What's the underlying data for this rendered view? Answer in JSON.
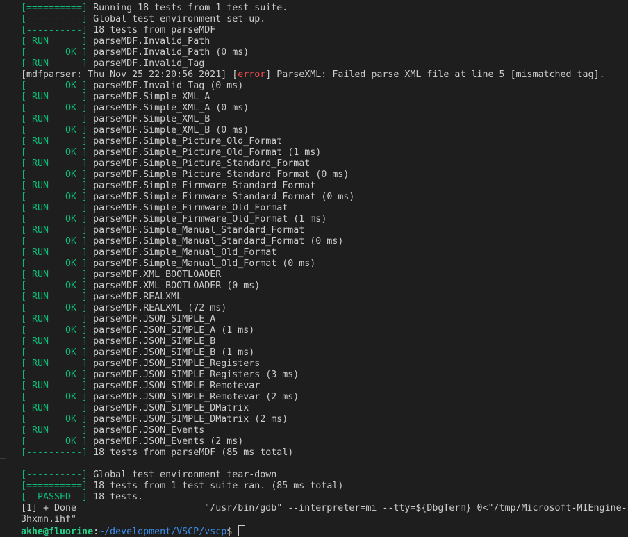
{
  "terminal": {
    "lines": [
      {
        "tag": "[==========]",
        "text": "Running 18 tests from 1 test suite."
      },
      {
        "tag": "[----------]",
        "text": "Global test environment set-up."
      },
      {
        "tag": "[----------]",
        "text": "18 tests from parseMDF"
      },
      {
        "tag": "[ RUN      ]",
        "text": "parseMDF.Invalid_Path"
      },
      {
        "tag": "[       OK ]",
        "text": "parseMDF.Invalid_Path (0 ms)"
      },
      {
        "tag": "[ RUN      ]",
        "text": "parseMDF.Invalid_Tag"
      },
      {
        "pre": "[mdfparser: Thu Nov 25 22:20:56 2021] [",
        "err": "error",
        "post": "] ParseXML: Failed parse XML file at line 5 [mismatched tag]."
      },
      {
        "tag": "[       OK ]",
        "text": "parseMDF.Invalid_Tag (0 ms)"
      },
      {
        "tag": "[ RUN      ]",
        "text": "parseMDF.Simple_XML_A"
      },
      {
        "tag": "[       OK ]",
        "text": "parseMDF.Simple_XML_A (0 ms)"
      },
      {
        "tag": "[ RUN      ]",
        "text": "parseMDF.Simple_XML_B"
      },
      {
        "tag": "[       OK ]",
        "text": "parseMDF.Simple_XML_B (0 ms)"
      },
      {
        "tag": "[ RUN      ]",
        "text": "parseMDF.Simple_Picture_Old_Format"
      },
      {
        "tag": "[       OK ]",
        "text": "parseMDF.Simple_Picture_Old_Format (1 ms)"
      },
      {
        "tag": "[ RUN      ]",
        "text": "parseMDF.Simple_Picture_Standard_Format"
      },
      {
        "tag": "[       OK ]",
        "text": "parseMDF.Simple_Picture_Standard_Format (0 ms)"
      },
      {
        "tag": "[ RUN      ]",
        "text": "parseMDF.Simple_Firmware_Standard_Format"
      },
      {
        "tag": "[       OK ]",
        "text": "parseMDF.Simple_Firmware_Standard_Format (0 ms)"
      },
      {
        "tag": "[ RUN      ]",
        "text": "parseMDF.Simple_Firmware_Old_Format"
      },
      {
        "tag": "[       OK ]",
        "text": "parseMDF.Simple_Firmware_Old_Format (1 ms)"
      },
      {
        "tag": "[ RUN      ]",
        "text": "parseMDF.Simple_Manual_Standard_Format"
      },
      {
        "tag": "[       OK ]",
        "text": "parseMDF.Simple_Manual_Standard_Format (0 ms)"
      },
      {
        "tag": "[ RUN      ]",
        "text": "parseMDF.Simple_Manual_Old_Format"
      },
      {
        "tag": "[       OK ]",
        "text": "parseMDF.Simple_Manual_Old_Format (0 ms)"
      },
      {
        "tag": "[ RUN      ]",
        "text": "parseMDF.XML_BOOTLOADER"
      },
      {
        "tag": "[       OK ]",
        "text": "parseMDF.XML_BOOTLOADER (0 ms)"
      },
      {
        "tag": "[ RUN      ]",
        "text": "parseMDF.REALXML"
      },
      {
        "tag": "[       OK ]",
        "text": "parseMDF.REALXML (72 ms)"
      },
      {
        "tag": "[ RUN      ]",
        "text": "parseMDF.JSON_SIMPLE_A"
      },
      {
        "tag": "[       OK ]",
        "text": "parseMDF.JSON_SIMPLE_A (1 ms)"
      },
      {
        "tag": "[ RUN      ]",
        "text": "parseMDF.JSON_SIMPLE_B"
      },
      {
        "tag": "[       OK ]",
        "text": "parseMDF.JSON_SIMPLE_B (1 ms)"
      },
      {
        "tag": "[ RUN      ]",
        "text": "parseMDF.JSON_SIMPLE_Registers"
      },
      {
        "tag": "[       OK ]",
        "text": "parseMDF.JSON_SIMPLE_Registers (3 ms)"
      },
      {
        "tag": "[ RUN      ]",
        "text": "parseMDF.JSON_SIMPLE_Remotevar"
      },
      {
        "tag": "[       OK ]",
        "text": "parseMDF.JSON_SIMPLE_Remotevar (2 ms)"
      },
      {
        "tag": "[ RUN      ]",
        "text": "parseMDF.JSON_SIMPLE_DMatrix"
      },
      {
        "tag": "[       OK ]",
        "text": "parseMDF.JSON_SIMPLE_DMatrix (2 ms)"
      },
      {
        "tag": "[ RUN      ]",
        "text": "parseMDF.JSON_Events"
      },
      {
        "tag": "[       OK ]",
        "text": "parseMDF.JSON_Events (2 ms)"
      },
      {
        "tag": "[----------]",
        "text": "18 tests from parseMDF (85 ms total)"
      },
      {
        "plain": ""
      },
      {
        "tag": "[----------]",
        "text": "Global test environment tear-down"
      },
      {
        "tag": "[==========]",
        "text": "18 tests from 1 test suite ran. (85 ms total)"
      },
      {
        "tag": "[  PASSED  ]",
        "text": "18 tests."
      },
      {
        "plain": "[1] + Done                       \"/usr/bin/gdb\" --interpreter=mi --tty=${DbgTerm} 0<\"/tmp/Microsoft-MIEngine-In-"
      },
      {
        "plain": "3hxmn.ihf\""
      }
    ],
    "prompt": {
      "user_host": "akhe@fluorine",
      "separator": ":",
      "path": "~/development/VSCP/vscp",
      "symbol": "$ "
    }
  },
  "colors": {
    "background": "#1e1e1e",
    "text": "#cccccc",
    "tag_green": "#0dbc79",
    "error_red": "#f14c4c",
    "prompt_green": "#23d18b",
    "path_blue": "#3b8eea"
  }
}
